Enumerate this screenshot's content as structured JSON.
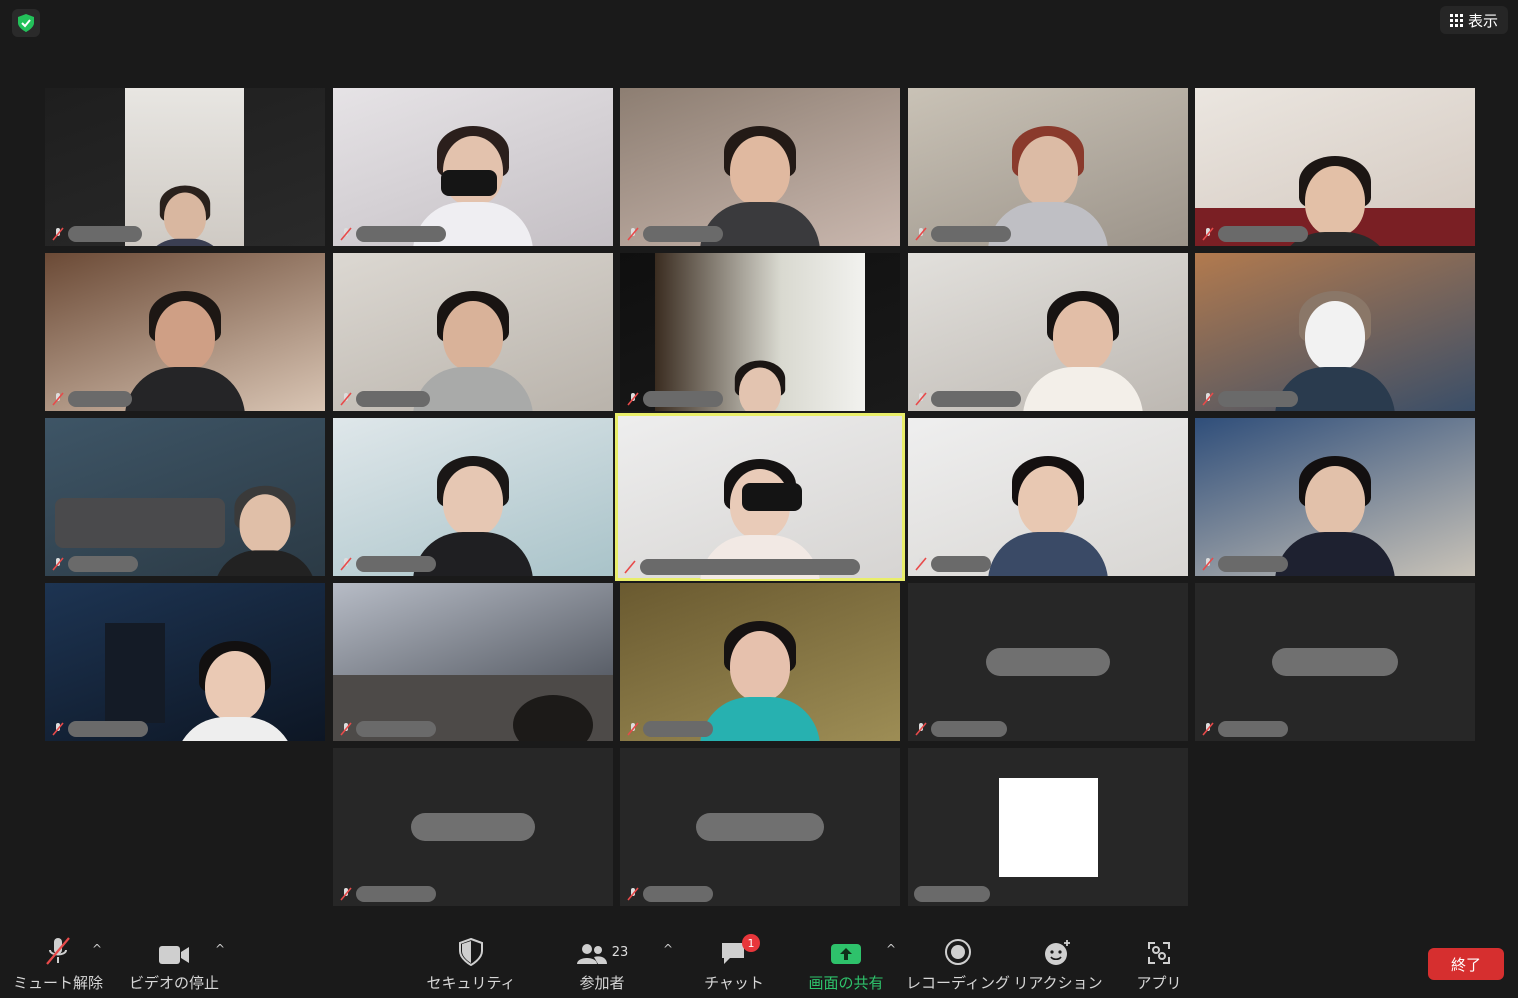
{
  "top": {
    "view_label": "表示"
  },
  "toolbar": {
    "unmute_label": "ミュート解除",
    "stop_video_label": "ビデオの停止",
    "security_label": "セキュリティ",
    "participants_label": "参加者",
    "participant_count": "23",
    "chat_label": "チャット",
    "chat_badge": "1",
    "share_label": "画面の共有",
    "record_label": "レコーディング",
    "reaction_label": "リアクション",
    "apps_label": "アプリ",
    "end_label": "終了"
  },
  "colors": {
    "active_outline": "#e9ee6a",
    "end_red": "#d62f2f",
    "share_green": "#2ec26b",
    "mute_red": "#e84a4a"
  }
}
